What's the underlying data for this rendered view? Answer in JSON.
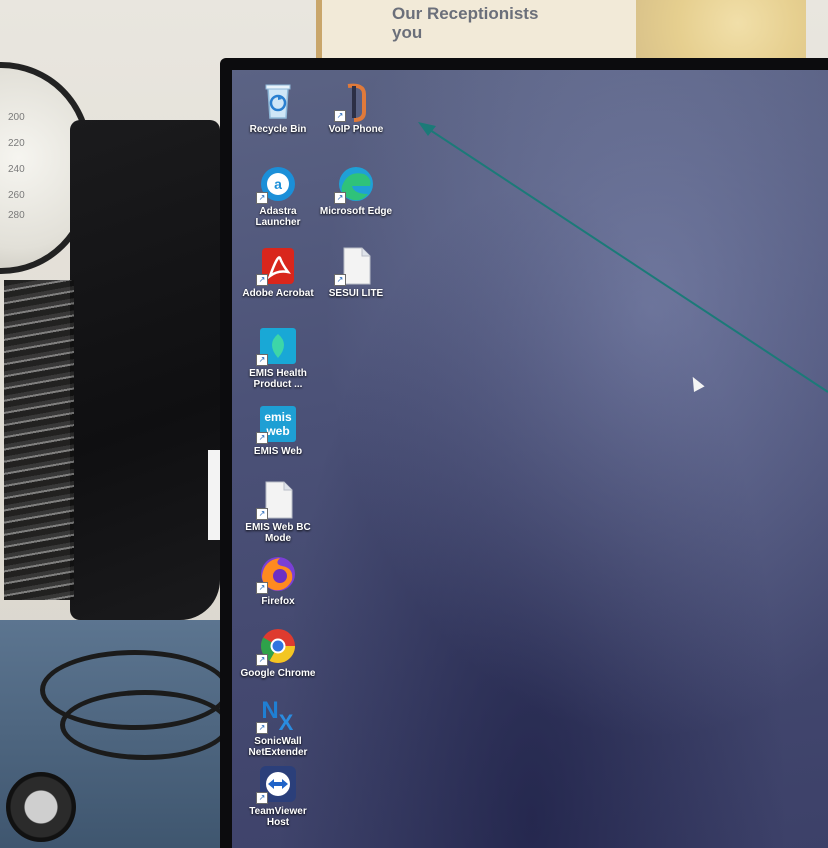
{
  "background": {
    "poster_text": "Our Receptionists\nyou",
    "gauge_ticks": [
      "200",
      "220",
      "240",
      "260",
      "280"
    ]
  },
  "desktop": {
    "icons": [
      {
        "label": "Recycle Bin",
        "icon": "recycle-bin-icon"
      },
      {
        "label": "VoIP Phone",
        "icon": "voip-phone-icon"
      },
      {
        "label": "Adastra Launcher",
        "icon": "adastra-icon"
      },
      {
        "label": "Microsoft Edge",
        "icon": "edge-icon"
      },
      {
        "label": "Adobe Acrobat",
        "icon": "acrobat-icon"
      },
      {
        "label": "SESUI LITE",
        "icon": "document-icon"
      },
      {
        "label": "EMIS Health Product ...",
        "icon": "emis-health-icon"
      },
      {
        "label": "EMIS Web",
        "icon": "emis-web-icon"
      },
      {
        "label": "EMIS Web BC Mode",
        "icon": "document-icon"
      },
      {
        "label": "Firefox",
        "icon": "firefox-icon"
      },
      {
        "label": "Google Chrome",
        "icon": "chrome-icon"
      },
      {
        "label": "SonicWall NetExtender",
        "icon": "netextender-icon"
      },
      {
        "label": "TeamViewer Host",
        "icon": "teamviewer-icon"
      }
    ]
  },
  "annotation": {
    "type": "arrow",
    "color": "#1b7a78",
    "points_to": "VoIP Phone"
  },
  "colors": {
    "desktop_top": "#5b6384",
    "desktop_bottom": "#3c4068",
    "label": "#ffffff"
  }
}
